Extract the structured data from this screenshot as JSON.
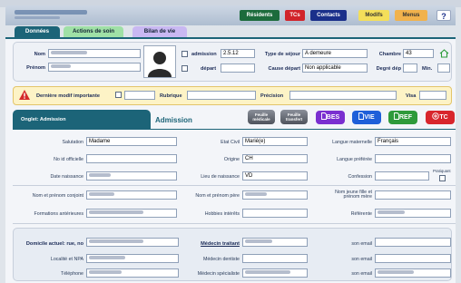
{
  "nav": {
    "residents": "Résidents",
    "tcs": "TCs",
    "contacts": "Contacts",
    "modifs": "Modifs",
    "menus": "Menus",
    "help": "?"
  },
  "tabs": {
    "donnees": "Données",
    "actions": "Actions de soin",
    "bilan": "Bilan de vie"
  },
  "identity": {
    "nom_label": "Nom",
    "prenom_label": "Prénom",
    "admission_label": "admission",
    "admission_value": "2.5.12",
    "depart_label": "départ",
    "type_sejour_label": "Type de séjour",
    "type_sejour_value": "A demeure",
    "cause_depart_label": "Cause départ",
    "cause_depart_value": "Non applicable",
    "chambre_label": "Chambre",
    "chambre_value": "43",
    "degre_label": "Degré dép",
    "min_label": "Min."
  },
  "alert": {
    "derniere_label": "Dernière modif importante",
    "rubrique_label": "Rubrique",
    "precision_label": "Précision",
    "visa_label": "Visa"
  },
  "section": {
    "onglet_label": "Onglet: Admission",
    "title": "Admission",
    "feuille_medicale": "Feuille médicale",
    "feuille_transfert": "Feuille transfert",
    "bes": "BES",
    "vie": "VIE",
    "ref": "REF",
    "tc": "TC"
  },
  "admission": {
    "salutation_label": "Salutation",
    "salutation_value": "Madame",
    "no_id_label": "No id officielle",
    "date_naissance_label": "Date naissance",
    "etat_civil_label": "Etat Civil",
    "etat_civil_value": "Marié(e)",
    "origine_label": "Origine",
    "origine_value": "CH",
    "lieu_naissance_label": "Lieu de naissance",
    "lieu_naissance_value": "VD",
    "langue_mat_label": "Langue maternelle",
    "langue_mat_value": "Français",
    "langue_pref_label": "Langue préférée",
    "confession_label": "Confession",
    "pratiquant_label": "Pratiquant",
    "conjoint_label": "Nom et prénom conjoint",
    "formations_label": "Formations antérieures",
    "pere_label": "Nom et prénom père",
    "hobbies_label": "Hobbies intérêts",
    "fils_label": "Nom jeune fille et prénom mère",
    "referente_label": "Référente"
  },
  "contact": {
    "domicile_label": "Domicile actuel: rue, no",
    "localite_label": "Localité et NPA",
    "telephone_label": "Téléphone",
    "medecin_traitant_label": "Médecin traitant",
    "medecin_dentiste_label": "Médecin dentiste",
    "medecin_specialiste_label": "Médecin spécialiste",
    "email_label": "son email"
  },
  "colors": {
    "residents": "#1c6b3c",
    "tcs": "#d1232a",
    "contacts": "#1a2f8a",
    "modifs": "#f4df5a",
    "menus": "#f1b24c",
    "bes": "#7a2fd0",
    "vie": "#1e5fd9",
    "ref": "#2e9a3a",
    "tc": "#d8262c",
    "header_teal": "#1c6478"
  }
}
